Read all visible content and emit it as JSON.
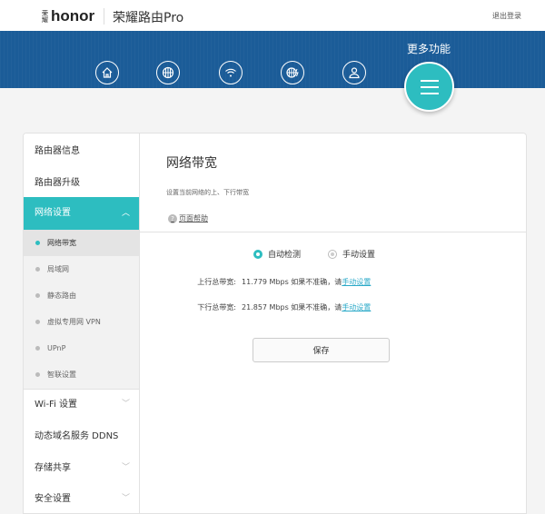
{
  "header": {
    "brand": "honor",
    "brand_small": "荣耀",
    "product": "荣耀路由Pro",
    "logout": "退出登录"
  },
  "nav": {
    "items": [
      "home-icon",
      "internet-icon",
      "wifi-icon",
      "network-speed-icon",
      "user-icon"
    ],
    "more_label": "更多功能"
  },
  "sidebar": {
    "items": [
      {
        "label": "路由器信息"
      },
      {
        "label": "路由器升级"
      },
      {
        "label": "网络设置",
        "expanded": true
      }
    ],
    "sub_items": [
      {
        "label": "网络带宽",
        "selected": true
      },
      {
        "label": "局域网"
      },
      {
        "label": "静态路由"
      },
      {
        "label": "虚拟专用网 VPN"
      },
      {
        "label": "UPnP"
      },
      {
        "label": "智联设置"
      }
    ],
    "bottom_items": [
      {
        "label": "Wi-Fi 设置"
      },
      {
        "label": "动态域名服务 DDNS"
      },
      {
        "label": "存储共享"
      },
      {
        "label": "安全设置"
      }
    ]
  },
  "main": {
    "title": "网络带宽",
    "description": "设置当前网络的上、下行带宽",
    "help": "页面帮助",
    "mode_auto": "自动检测",
    "mode_manual": "手动设置",
    "selected_mode": "自动检测",
    "upload_label": "上行总带宽:",
    "upload_value": "11.779 Mbps 如果不准确，请",
    "upload_link": "手动设置",
    "download_label": "下行总带宽:",
    "download_value": "21.857 Mbps 如果不准确，请",
    "download_link": "手动设置",
    "save": "保存"
  },
  "colors": {
    "accent": "#2dbdc0",
    "band": "#1b5c98"
  }
}
